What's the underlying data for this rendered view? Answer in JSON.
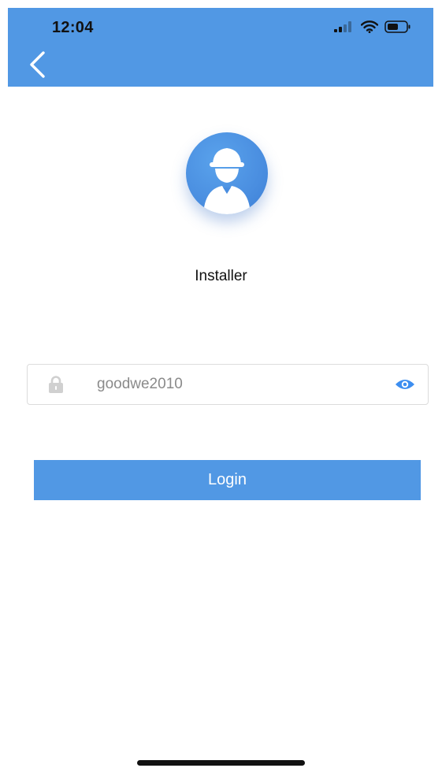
{
  "status_bar": {
    "time": "12:04",
    "icons": [
      "signal-icon",
      "wifi-icon",
      "battery-icon"
    ]
  },
  "header": {
    "back_icon": "chevron-left-icon",
    "color": "#5198e4"
  },
  "profile": {
    "avatar_icon": "installer-avatar-icon",
    "role_label": "Installer"
  },
  "password": {
    "lock_icon": "lock-icon",
    "value": "goodwe2010",
    "eye_icon": "eye-icon"
  },
  "login": {
    "label": "Login"
  },
  "colors": {
    "accent": "#5198e4",
    "eye": "#3d8ef0",
    "lock": "#d0d0d0"
  }
}
